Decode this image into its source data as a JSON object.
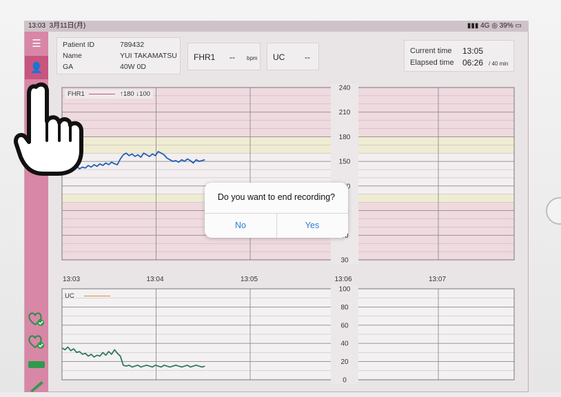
{
  "status_bar": {
    "time": "13:03",
    "date": "3月11日(月)",
    "network": "4G",
    "battery": "39%"
  },
  "patient": {
    "id_label": "Patient ID",
    "id_value": "789432",
    "name_label": "Name",
    "name_value": "YUI TAKAMATSU",
    "ga_label": "GA",
    "ga_value": "40W 0D"
  },
  "fhr_box": {
    "label": "FHR1",
    "value": "--",
    "unit": "bpm"
  },
  "uc_box": {
    "label": "UC",
    "value": "--"
  },
  "timing": {
    "current_label": "Current time",
    "current_value": "13:05",
    "elapsed_label": "Elapsed time",
    "elapsed_value": "06:26",
    "elapsed_total": "/ 40 min"
  },
  "dialog": {
    "message": "Do you want to end recording?",
    "no_label": "No",
    "yes_label": "Yes"
  },
  "colors": {
    "sidebar": "#d887a6",
    "sidebar_active": "#c8557f",
    "fhr_line": "#1f5fb4",
    "uc_line": "#2f7a5a",
    "dialog_button": "#2f7bd3"
  },
  "chart_data": [
    {
      "type": "line",
      "legend": "FHR1",
      "legend_limits": "↑180 ↓100",
      "ylim": [
        30,
        240
      ],
      "y_ticks": [
        "240",
        "210",
        "180",
        "150",
        "120",
        "90",
        "60",
        "30"
      ],
      "x_ticks": [
        "13:03",
        "13:04",
        "13:05",
        "13:06",
        "13:07"
      ],
      "series": [
        {
          "x_minutes": [
            0,
            0.05,
            0.1,
            0.15,
            0.2,
            0.25,
            0.3,
            0.35,
            0.4,
            0.45,
            0.5,
            0.55,
            0.6,
            0.65,
            0.7,
            0.75,
            0.8,
            0.85,
            0.9,
            0.95,
            1.0,
            1.05,
            1.1,
            1.15,
            1.2,
            1.25,
            1.3,
            1.35,
            1.4,
            1.45,
            1.5,
            1.55,
            1.6,
            1.65,
            1.7,
            1.75,
            1.8,
            1.85,
            1.9,
            1.95,
            2.0,
            2.05,
            2.1,
            2.15,
            2.2,
            2.25,
            2.3,
            2.35,
            2.4,
            2.45
          ],
          "y": [
            141,
            143,
            139,
            142,
            140,
            144,
            141,
            143,
            142,
            145,
            143,
            146,
            144,
            147,
            145,
            148,
            146,
            149,
            147,
            146,
            153,
            158,
            160,
            157,
            159,
            156,
            158,
            155,
            160,
            158,
            156,
            159,
            157,
            162,
            160,
            158,
            154,
            152,
            150,
            151,
            149,
            152,
            150,
            153,
            151,
            148,
            152,
            150,
            151,
            152
          ]
        }
      ]
    },
    {
      "type": "line",
      "legend": "UC",
      "ylim": [
        0,
        100
      ],
      "y_ticks": [
        "100",
        "80",
        "60",
        "40",
        "20",
        "0"
      ],
      "series": [
        {
          "x_minutes": [
            0,
            0.05,
            0.1,
            0.15,
            0.2,
            0.25,
            0.3,
            0.35,
            0.4,
            0.45,
            0.5,
            0.55,
            0.6,
            0.65,
            0.7,
            0.75,
            0.8,
            0.85,
            0.9,
            0.95,
            1.0,
            1.05,
            1.1,
            1.15,
            1.2,
            1.25,
            1.3,
            1.35,
            1.4,
            1.45,
            1.5,
            1.55,
            1.6,
            1.65,
            1.7,
            1.75,
            1.8,
            1.85,
            1.9,
            1.95,
            2.0,
            2.05,
            2.1,
            2.15,
            2.2,
            2.25,
            2.3,
            2.35,
            2.4,
            2.45
          ],
          "y": [
            35,
            33,
            36,
            32,
            34,
            30,
            31,
            28,
            29,
            26,
            28,
            25,
            27,
            26,
            30,
            27,
            31,
            28,
            33,
            29,
            26,
            16,
            15,
            16,
            14,
            15,
            16,
            14,
            15,
            16,
            15,
            14,
            16,
            15,
            14,
            16,
            15,
            14,
            15,
            16,
            15,
            14,
            15,
            16,
            14,
            15,
            16,
            15,
            14,
            15
          ]
        }
      ]
    }
  ]
}
